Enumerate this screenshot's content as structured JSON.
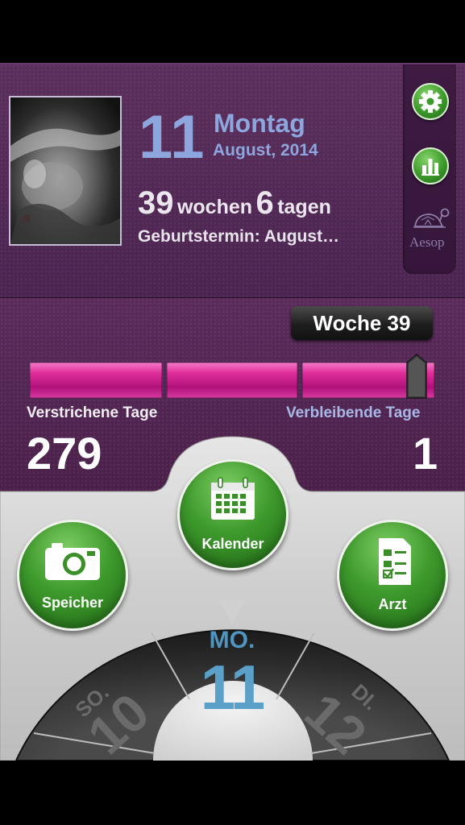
{
  "header": {
    "day_number": "11",
    "weekday": "Montag",
    "month_year": "August, 2014",
    "weeks_value": "39",
    "weeks_label": "wochen",
    "days_value": "6",
    "days_label": "tagen",
    "due_date_text": "Geburtstermin: August…"
  },
  "sidebar": {
    "aesop_label": "Aesop",
    "icons": [
      "gear-icon",
      "bar-chart-icon",
      "turtle-icon"
    ]
  },
  "progress": {
    "week_badge": "Woche 39",
    "elapsed_label": "Verstrichene Tage",
    "remaining_label": "Verbleibende Tage",
    "elapsed_days": "279",
    "remaining_days": "1",
    "fraction": 0.996
  },
  "actions": {
    "calendar_label": "Kalender",
    "memory_label": "Speicher",
    "doctor_label": "Arzt"
  },
  "wheel": {
    "current_abbr": "MO.",
    "current_day": "11",
    "prev_abbr": "SO.",
    "prev_day": "10",
    "next_abbr": "DI.",
    "next_day": "12"
  },
  "colors": {
    "accent_blue": "#8ea6de",
    "progress_pink": "#e02e9a",
    "button_green": "#3e9a2c",
    "background_purple": "#4f2552"
  }
}
